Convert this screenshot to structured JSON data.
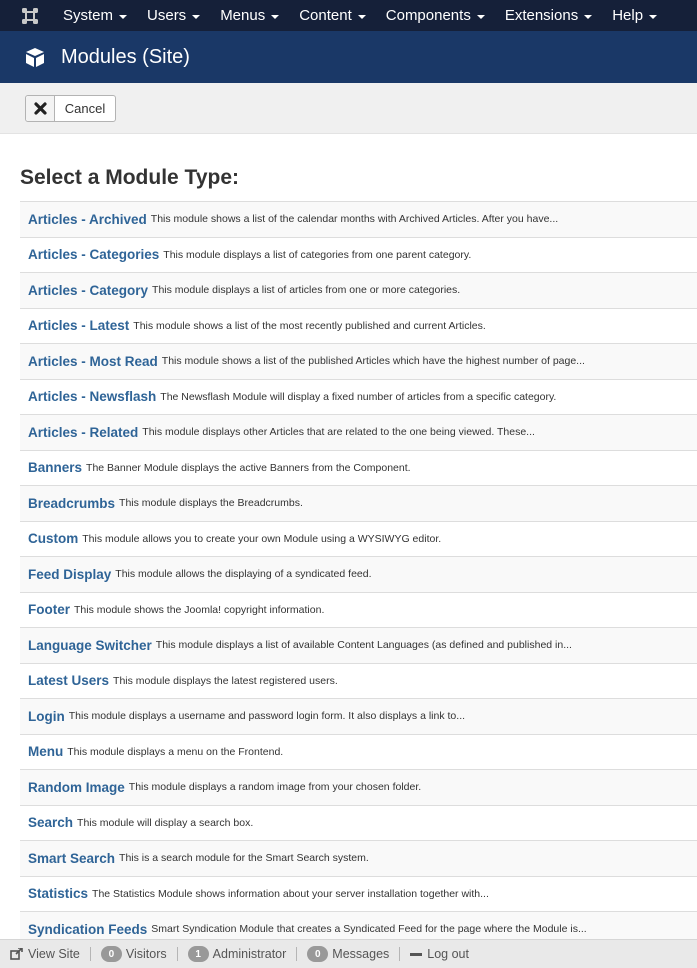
{
  "topnav": {
    "logo_icon": "joomla-logo-icon",
    "menus": [
      {
        "label": "System"
      },
      {
        "label": "Users"
      },
      {
        "label": "Menus"
      },
      {
        "label": "Content"
      },
      {
        "label": "Components"
      },
      {
        "label": "Extensions"
      },
      {
        "label": "Help"
      }
    ]
  },
  "header": {
    "icon": "cube-icon",
    "title": "Modules (Site)"
  },
  "toolbar": {
    "cancel_icon": "close-icon",
    "cancel_label": "Cancel"
  },
  "main": {
    "heading": "Select a Module Type:",
    "modules": [
      {
        "name": "Articles - Archived",
        "description": "This module shows a list of the calendar months with Archived Articles. After you have..."
      },
      {
        "name": "Articles - Categories",
        "description": "This module displays a list of categories from one parent category."
      },
      {
        "name": "Articles - Category",
        "description": "This module displays a list of articles from one or more categories."
      },
      {
        "name": "Articles - Latest",
        "description": "This module shows a list of the most recently published and current Articles."
      },
      {
        "name": "Articles - Most Read",
        "description": "This module shows a list of the published Articles which have the highest number of page..."
      },
      {
        "name": "Articles - Newsflash",
        "description": "The Newsflash Module will display a fixed number of articles from a specific category."
      },
      {
        "name": "Articles - Related",
        "description": "This module displays other Articles that are related to the one being viewed. These..."
      },
      {
        "name": "Banners",
        "description": "The Banner Module displays the active Banners from the Component."
      },
      {
        "name": "Breadcrumbs",
        "description": "This module displays the Breadcrumbs."
      },
      {
        "name": "Custom",
        "description": "This module allows you to create your own Module using a WYSIWYG editor."
      },
      {
        "name": "Feed Display",
        "description": "This module allows the displaying of a syndicated feed."
      },
      {
        "name": "Footer",
        "description": "This module shows the Joomla! copyright information."
      },
      {
        "name": "Language Switcher",
        "description": "This module displays a list of available Content Languages (as defined and published in..."
      },
      {
        "name": "Latest Users",
        "description": "This module displays the latest registered users."
      },
      {
        "name": "Login",
        "description": "This module displays a username and password login form. It also displays a link to..."
      },
      {
        "name": "Menu",
        "description": "This module displays a menu on the Frontend."
      },
      {
        "name": "Random Image",
        "description": "This module displays a random image from your chosen folder."
      },
      {
        "name": "Search",
        "description": "This module will display a search box."
      },
      {
        "name": "Smart Search",
        "description": "This is a search module for the Smart Search system."
      },
      {
        "name": "Statistics",
        "description": "The Statistics Module shows information about your server installation together with..."
      },
      {
        "name": "Syndication Feeds",
        "description": "Smart Syndication Module that creates a Syndicated Feed for the page where the Module is..."
      }
    ]
  },
  "statusbar": {
    "view_site_icon": "external-link-icon",
    "view_site_label": "View Site",
    "visitors_count": "0",
    "visitors_label": "Visitors",
    "admin_count": "1",
    "admin_label": "Administrator",
    "messages_count": "0",
    "messages_label": "Messages",
    "logout_icon": "minus-icon",
    "logout_label": "Log out"
  },
  "colors": {
    "topnav_bg": "#152039",
    "header_bg": "#1a3867",
    "link": "#2f6497",
    "toolbar_bg": "#f0f0f0",
    "badge_bg": "#999999"
  }
}
